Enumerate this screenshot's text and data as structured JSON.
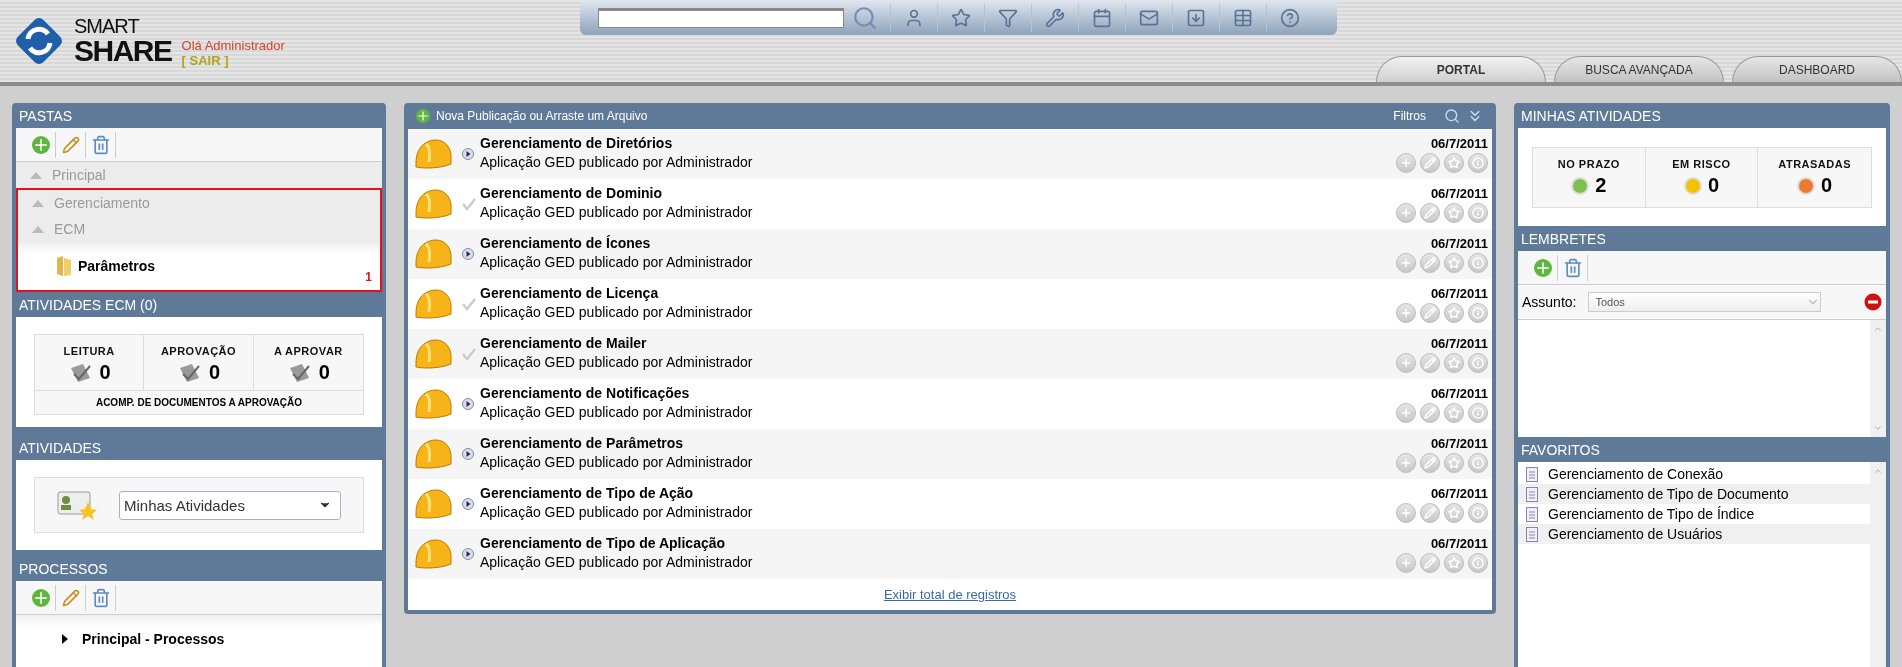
{
  "header": {
    "logo_top": "SMART",
    "logo_bottom": "SHARE",
    "greeting": "Olá Administrador",
    "logout": "[ SAIR ]"
  },
  "tabs": [
    {
      "label": "PORTAL",
      "selected": true
    },
    {
      "label": "BUSCA AVANÇADA",
      "selected": false
    },
    {
      "label": "DASHBOARD",
      "selected": false
    }
  ],
  "folders": {
    "title": "PASTAS",
    "breadcrumb": [
      "Principal",
      "Gerenciamento",
      "ECM"
    ],
    "current": "Parâmetros",
    "annotation": "1"
  },
  "ecm_activities": {
    "title": "ATIVIDADES ECM (0)",
    "stats": [
      {
        "label": "LEITURA",
        "value": "0"
      },
      {
        "label": "APROVAÇÃO",
        "value": "0"
      },
      {
        "label": "A APROVAR",
        "value": "0"
      }
    ],
    "footer": "ACOMP. DE DOCUMENTOS A APROVAÇÃO"
  },
  "activities": {
    "title": "ATIVIDADES",
    "select": "Minhas Atividades"
  },
  "processes": {
    "title": "PROCESSOS",
    "items": [
      {
        "label": "Principal - Processos",
        "expanded": false
      }
    ]
  },
  "publications": {
    "new_label": "Nova Publicação ou Arraste um Arquivo",
    "filters": "Filtros",
    "footer_link": "Exibir total de registros",
    "rows": [
      {
        "title": "Gerenciamento de Diretórios",
        "subtitle": "Aplicação GED publicado por Administrador",
        "date": "06/7/2011",
        "kind": "arrow"
      },
      {
        "title": "Gerenciamento de Dominio",
        "subtitle": "Aplicação GED publicado por Administrador",
        "date": "06/7/2011",
        "kind": "check"
      },
      {
        "title": "Gerenciamento de Ícones",
        "subtitle": "Aplicação GED publicado por Administrador",
        "date": "06/7/2011",
        "kind": "arrow"
      },
      {
        "title": "Gerenciamento de Licença",
        "subtitle": "Aplicação GED publicado por Administrador",
        "date": "06/7/2011",
        "kind": "check"
      },
      {
        "title": "Gerenciamento de Mailer",
        "subtitle": "Aplicação GED publicado por Administrador",
        "date": "06/7/2011",
        "kind": "check"
      },
      {
        "title": "Gerenciamento de Notificações",
        "subtitle": "Aplicação GED publicado por Administrador",
        "date": "06/7/2011",
        "kind": "arrow"
      },
      {
        "title": "Gerenciamento de Parâmetros",
        "subtitle": "Aplicação GED publicado por Administrador",
        "date": "06/7/2011",
        "kind": "arrow"
      },
      {
        "title": "Gerenciamento de Tipo de Ação",
        "subtitle": "Aplicação GED publicado por Administrador",
        "date": "06/7/2011",
        "kind": "arrow"
      },
      {
        "title": "Gerenciamento de Tipo de Aplicação",
        "subtitle": "Aplicação GED publicado por Administrador",
        "date": "06/7/2011",
        "kind": "arrow"
      }
    ]
  },
  "my_activities": {
    "title": "MINHAS ATIVIDADES",
    "stats": [
      {
        "label": "NO PRAZO",
        "value": "2",
        "color": "#7cc04f"
      },
      {
        "label": "EM RISCO",
        "value": "0",
        "color": "#f5c200"
      },
      {
        "label": "ATRASADAS",
        "value": "0",
        "color": "#ee7a32"
      }
    ]
  },
  "reminders": {
    "title": "LEMBRETES",
    "subject_label": "Assunto:",
    "subject_value": "Todos"
  },
  "favorites": {
    "title": "FAVORITOS",
    "items": [
      "Gerenciamento de Conexão",
      "Gerenciamento de Tipo de Documento",
      "Gerenciamento de Tipo de Índice",
      "Gerenciamento de Usuários"
    ]
  }
}
